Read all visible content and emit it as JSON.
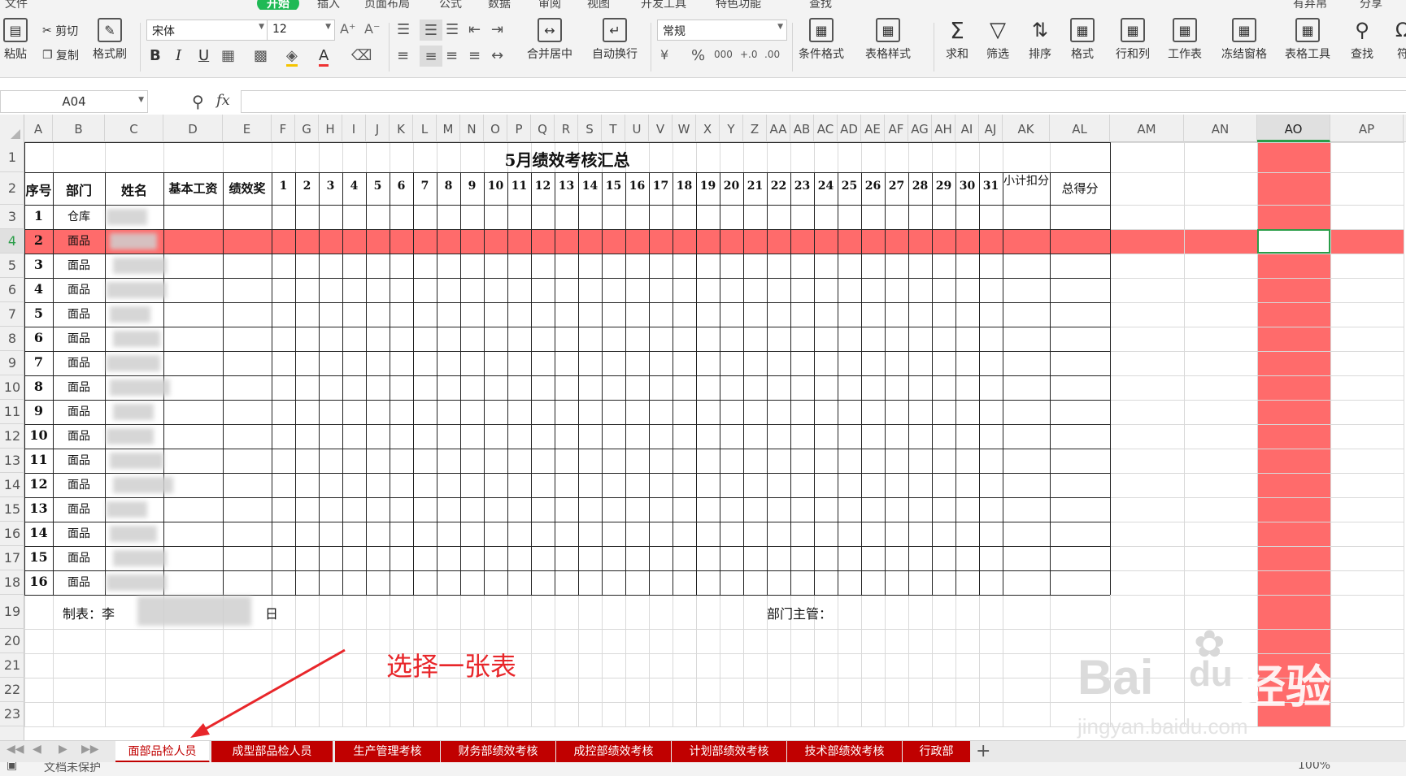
{
  "menubar": {
    "items": [
      "文件",
      "开始",
      "插入",
      "页面布局",
      "公式",
      "数据",
      "审阅",
      "视图",
      "开发工具",
      "特色功能",
      "查找",
      "有弃帛",
      "分享"
    ],
    "active": "开始"
  },
  "ribbon": {
    "paste": "粘贴",
    "cut": "剪切",
    "copy": "复制",
    "format_painter": "格式刷",
    "font_name": "宋体",
    "font_size": "12",
    "bold": "B",
    "italic": "I",
    "underline": "U",
    "font_color": "A",
    "merge_center": "合并居中",
    "wrap_text": "自动换行",
    "number_format": "常规",
    "currency": "¥",
    "percent": "%",
    "thousands": "000",
    "inc_decimal": "+.0",
    "dec_decimal": ".00",
    "conditional_format": "条件格式",
    "table_style": "表格样式",
    "sum": "求和",
    "filter": "筛选",
    "sort": "排序",
    "format": "格式",
    "rows_cols": "行和列",
    "worksheet": "工作表",
    "freeze": "冻结窗格",
    "table_tools": "表格工具",
    "find": "查找",
    "symbol": "符"
  },
  "formula_bar": {
    "name_box": "A04",
    "fx": "fx",
    "value": ""
  },
  "columns": [
    "A",
    "B",
    "C",
    "D",
    "E",
    "F",
    "G",
    "H",
    "I",
    "J",
    "K",
    "L",
    "M",
    "N",
    "O",
    "P",
    "Q",
    "R",
    "S",
    "T",
    "U",
    "V",
    "W",
    "X",
    "Y",
    "Z",
    "AA",
    "AB",
    "AC",
    "AD",
    "AE",
    "AF",
    "AG",
    "AH",
    "AI",
    "AJ",
    "AK",
    "AL",
    "AM",
    "AN",
    "AO",
    "AP"
  ],
  "selected_column": "AO",
  "rows": [
    "1",
    "2",
    "3",
    "4",
    "5",
    "6",
    "7",
    "8",
    "9",
    "10",
    "11",
    "12",
    "13",
    "14",
    "15",
    "16",
    "17",
    "18",
    "19",
    "20",
    "21",
    "22",
    "23"
  ],
  "selected_row": "4",
  "sheet": {
    "title": "5月绩效考核汇总",
    "headers": {
      "seq": "序号",
      "dept": "部门",
      "name": "姓名",
      "base": "基本工资",
      "bonus": "绩效奖",
      "days": [
        "1",
        "2",
        "3",
        "4",
        "5",
        "6",
        "7",
        "8",
        "9",
        "10",
        "11",
        "12",
        "13",
        "14",
        "15",
        "16",
        "17",
        "18",
        "19",
        "20",
        "21",
        "22",
        "23",
        "24",
        "25",
        "26",
        "27",
        "28",
        "29",
        "30",
        "31"
      ],
      "subtotal": "小计扣分",
      "total": "总得分"
    },
    "data_rows": [
      {
        "seq": "1",
        "dept": "仓库"
      },
      {
        "seq": "2",
        "dept": "面品"
      },
      {
        "seq": "3",
        "dept": "面品"
      },
      {
        "seq": "4",
        "dept": "面品"
      },
      {
        "seq": "5",
        "dept": "面品"
      },
      {
        "seq": "6",
        "dept": "面品"
      },
      {
        "seq": "7",
        "dept": "面品"
      },
      {
        "seq": "8",
        "dept": "面品"
      },
      {
        "seq": "9",
        "dept": "面品"
      },
      {
        "seq": "10",
        "dept": "面品"
      },
      {
        "seq": "11",
        "dept": "面品"
      },
      {
        "seq": "12",
        "dept": "面品"
      },
      {
        "seq": "13",
        "dept": "面品"
      },
      {
        "seq": "14",
        "dept": "面品"
      },
      {
        "seq": "15",
        "dept": "面品"
      },
      {
        "seq": "16",
        "dept": "面品"
      }
    ],
    "maker_label": "制表：李",
    "date_suffix": "日",
    "supervisor_label": "部门主管："
  },
  "annotation": "选择一张表",
  "watermark": {
    "brand": "Bai",
    "paw": "du",
    "product": "经验",
    "url": "jingyan.baidu.com"
  },
  "tabs": [
    {
      "label": "面部品检人员",
      "active": true
    },
    {
      "label": "成型部品检人员",
      "active": false
    },
    {
      "label": "生产管理考核",
      "active": false
    },
    {
      "label": "财务部绩效考核",
      "active": false
    },
    {
      "label": "成控部绩效考核",
      "active": false
    },
    {
      "label": "计划部绩效考核",
      "active": false
    },
    {
      "label": "技术部绩效考核",
      "active": false
    },
    {
      "label": "行政部",
      "active": false
    }
  ],
  "add_tab": "+",
  "status": {
    "protect": "文档未保护",
    "zoom": "100%"
  },
  "colors": {
    "accent_green": "#2a9d48",
    "highlight_red": "#ff6b6b",
    "tab_red": "#c00000",
    "annotation_red": "#e8262a"
  }
}
